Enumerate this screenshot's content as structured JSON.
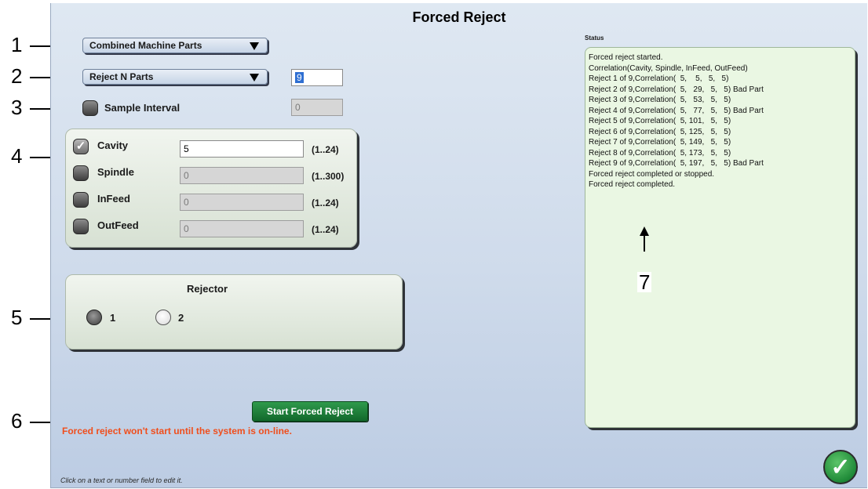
{
  "window": {
    "title": "Forced Reject"
  },
  "callouts": [
    "1",
    "2",
    "3",
    "4",
    "5",
    "6",
    "7"
  ],
  "selectors": {
    "mode_dropdown": "Combined Machine Parts",
    "reject_dropdown": "Reject N Parts",
    "reject_count_value": "9"
  },
  "sample_interval": {
    "label": "Sample Interval",
    "value": "0",
    "checked": false
  },
  "correlation": {
    "rows": [
      {
        "label": "Cavity",
        "value": "5",
        "range": "(1..24)",
        "checked": true
      },
      {
        "label": "Spindle",
        "value": "0",
        "range": "(1..300)",
        "checked": false
      },
      {
        "label": "InFeed",
        "value": "0",
        "range": "(1..24)",
        "checked": false
      },
      {
        "label": "OutFeed",
        "value": "0",
        "range": "(1..24)",
        "checked": false
      }
    ]
  },
  "rejector": {
    "title": "Rejector",
    "options": [
      {
        "label": "1",
        "selected": true
      },
      {
        "label": "2",
        "selected": false
      }
    ]
  },
  "actions": {
    "start_label": "Start Forced Reject",
    "warning": "Forced reject won't start until the system is on-line."
  },
  "footer": {
    "hint": "Click on a text or number field to edit it."
  },
  "status": {
    "label": "Status",
    "lines": [
      "Forced reject started.",
      "Correlation(Cavity, Spindle, InFeed, OutFeed)",
      "Reject 1 of 9,Correlation(  5,    5,   5,   5)",
      "Reject 2 of 9,Correlation(  5,   29,   5,   5) Bad Part",
      "Reject 3 of 9,Correlation(  5,   53,   5,   5)",
      "Reject 4 of 9,Correlation(  5,   77,   5,   5) Bad Part",
      "Reject 5 of 9,Correlation(  5, 101,   5,   5)",
      "Reject 6 of 9,Correlation(  5, 125,   5,   5)",
      "Reject 7 of 9,Correlation(  5, 149,   5,   5)",
      "Reject 8 of 9,Correlation(  5, 173,   5,   5)",
      "Reject 9 of 9,Correlation(  5, 197,   5,   5) Bad Part",
      "Forced reject completed or stopped.",
      "Forced reject completed."
    ]
  },
  "colors": {
    "warning": "#f04e1c",
    "start_button": "#1f7f3a",
    "ok_button": "#2e9a45"
  }
}
